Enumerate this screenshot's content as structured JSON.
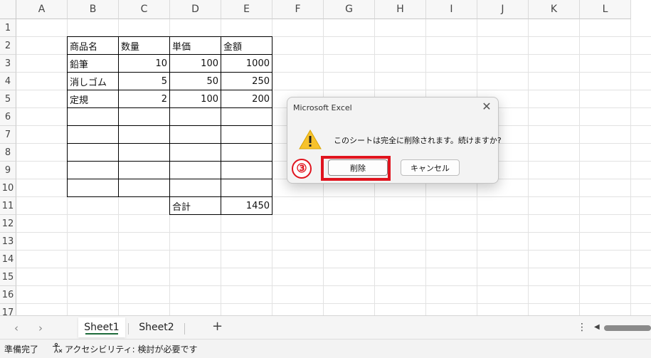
{
  "columns": [
    "A",
    "B",
    "C",
    "D",
    "E",
    "F",
    "G",
    "H",
    "I",
    "J",
    "K",
    "L"
  ],
  "rows": [
    "1",
    "2",
    "3",
    "4",
    "5",
    "6",
    "7",
    "8",
    "9",
    "10",
    "11",
    "12",
    "13",
    "14",
    "15",
    "16",
    "17"
  ],
  "table": {
    "headers": [
      "商品名",
      "数量",
      "単価",
      "金額"
    ],
    "rows": [
      [
        "鉛筆",
        "10",
        "100",
        "1000"
      ],
      [
        "消しゴム",
        "5",
        "50",
        "250"
      ],
      [
        "定規",
        "2",
        "100",
        "200"
      ]
    ],
    "total_label": "合計",
    "total_value": "1450"
  },
  "dialog": {
    "title": "Microsoft Excel",
    "message": "このシートは完全に削除されます。続けますか?",
    "delete_label": "削除",
    "cancel_label": "キャンセル",
    "icon": "warning-icon"
  },
  "annotation": {
    "step": "③",
    "color": "#e0141e"
  },
  "sheets": {
    "tab1": "Sheet1",
    "tab2": "Sheet2",
    "add": "+"
  },
  "status": {
    "ready": "準備完了",
    "accessibility": "アクセシビリティ: 検討が必要です"
  },
  "colors": {
    "active_tab_underline": "#1e6b3a",
    "highlight": "#e0141e"
  }
}
